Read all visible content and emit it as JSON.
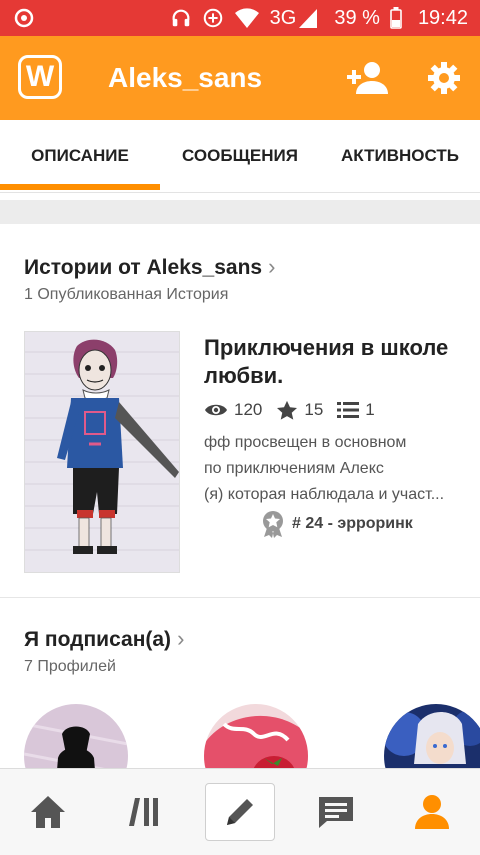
{
  "status_bar": {
    "network": "3G",
    "battery": "39 %",
    "time": "19:42"
  },
  "app_bar": {
    "logo_letter": "W",
    "title": "Aleks_sans"
  },
  "tabs": [
    {
      "label": "ОПИСАНИЕ",
      "active": true
    },
    {
      "label": "СООБЩЕНИЯ",
      "active": false
    },
    {
      "label": "АКТИВНОСТЬ",
      "active": false
    }
  ],
  "stories_section": {
    "title": "Истории от Aleks_sans",
    "subtitle": "1 Опубликованная История",
    "story": {
      "title": "Приключения в школе любви.",
      "reads": "120",
      "votes": "15",
      "parts": "1",
      "description_lines": [
        "фф просвещен в основном",
        "по приключениям Алекс",
        "(я) которая наблюдала и участ..."
      ],
      "rank": "# 24 - эрроринк"
    }
  },
  "following_section": {
    "title": "Я подписан(а)",
    "subtitle": "7 Профилей"
  },
  "colors": {
    "status_bar": "#e53935",
    "app_bar": "#ff9a1f",
    "accent": "#ff8f00"
  },
  "icons": {
    "status_left": "app-notification-icon",
    "headphones": "headphones-icon",
    "nfc": "nfc-icon",
    "wifi": "wifi-icon",
    "signal": "signal-icon",
    "battery": "battery-icon",
    "add_user": "add-user-icon",
    "settings": "gear-icon",
    "reads": "eye-icon",
    "votes": "star-icon",
    "parts": "list-icon",
    "rank": "medal-icon",
    "nav": [
      "home-icon",
      "library-icon",
      "pencil-icon",
      "messages-icon",
      "profile-icon"
    ]
  }
}
